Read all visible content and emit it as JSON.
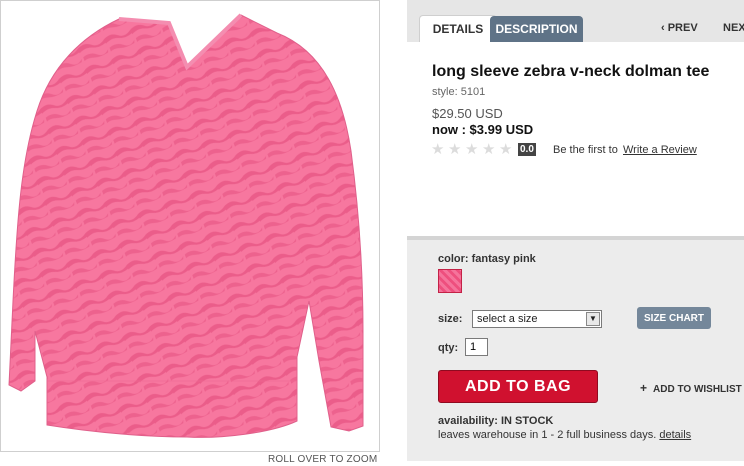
{
  "product_image": {
    "zoom_note": "ROLL OVER TO ZOOM"
  },
  "tabs": [
    {
      "label": "DETAILS"
    },
    {
      "label": "DESCRIPTION"
    }
  ],
  "nav": {
    "prev": "‹ PREV",
    "next": "NEXT"
  },
  "product": {
    "title": "long sleeve zebra v-neck dolman tee",
    "style": "style: 5101",
    "orig_price": "$29.50 USD",
    "now_price": "now : $3.99 USD",
    "rating": "0.0",
    "review_prompt": "Be the first to",
    "review_link": "Write a Review"
  },
  "options": {
    "color_label": "color: fantasy pink",
    "size_label": "size:",
    "size_value": "select a size",
    "size_chart": "SIZE CHART",
    "qty_label": "qty:",
    "qty_value": "1",
    "add_to_bag": "ADD TO BAG",
    "wishlist": "ADD TO WISHLIST",
    "availability": "availability: IN STOCK",
    "ship_text": "leaves warehouse in 1 - 2 full business days.",
    "details_link": "details"
  },
  "colors": {
    "accent": "#d0112f",
    "tab_active": "#5f7387",
    "shirt": "#f5739b"
  }
}
